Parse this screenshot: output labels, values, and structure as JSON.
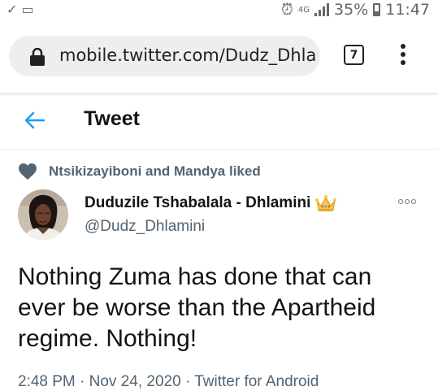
{
  "status_bar": {
    "left_icons": [
      "download-done-icon",
      "clipboard-icon"
    ],
    "alarm_icon": "alarm-icon",
    "network": "4G",
    "battery": "35%",
    "time": "11:47"
  },
  "browser": {
    "url": "mobile.twitter.com/Dudz_Dhlamini",
    "tab_count": "7",
    "lock_icon": "lock-icon",
    "menu_icon": "more-vertical-icon"
  },
  "header": {
    "title": "Tweet",
    "back_icon": "arrow-left-icon",
    "accent_color": "#1d9bf0"
  },
  "social_context": {
    "text": "Ntsikizayiboni and Mandya liked",
    "icon": "heart-icon"
  },
  "tweet": {
    "author_name": "Duduzile Tshabalala - Dhlamini",
    "author_emoji": "crown-icon",
    "handle": "@Dudz_Dhlamini",
    "text": "Nothing Zuma has done that can ever be worse than the Apartheid regime. Nothing!",
    "meta": "2:48 PM · Nov 24, 2020 · Twitter for Android"
  }
}
